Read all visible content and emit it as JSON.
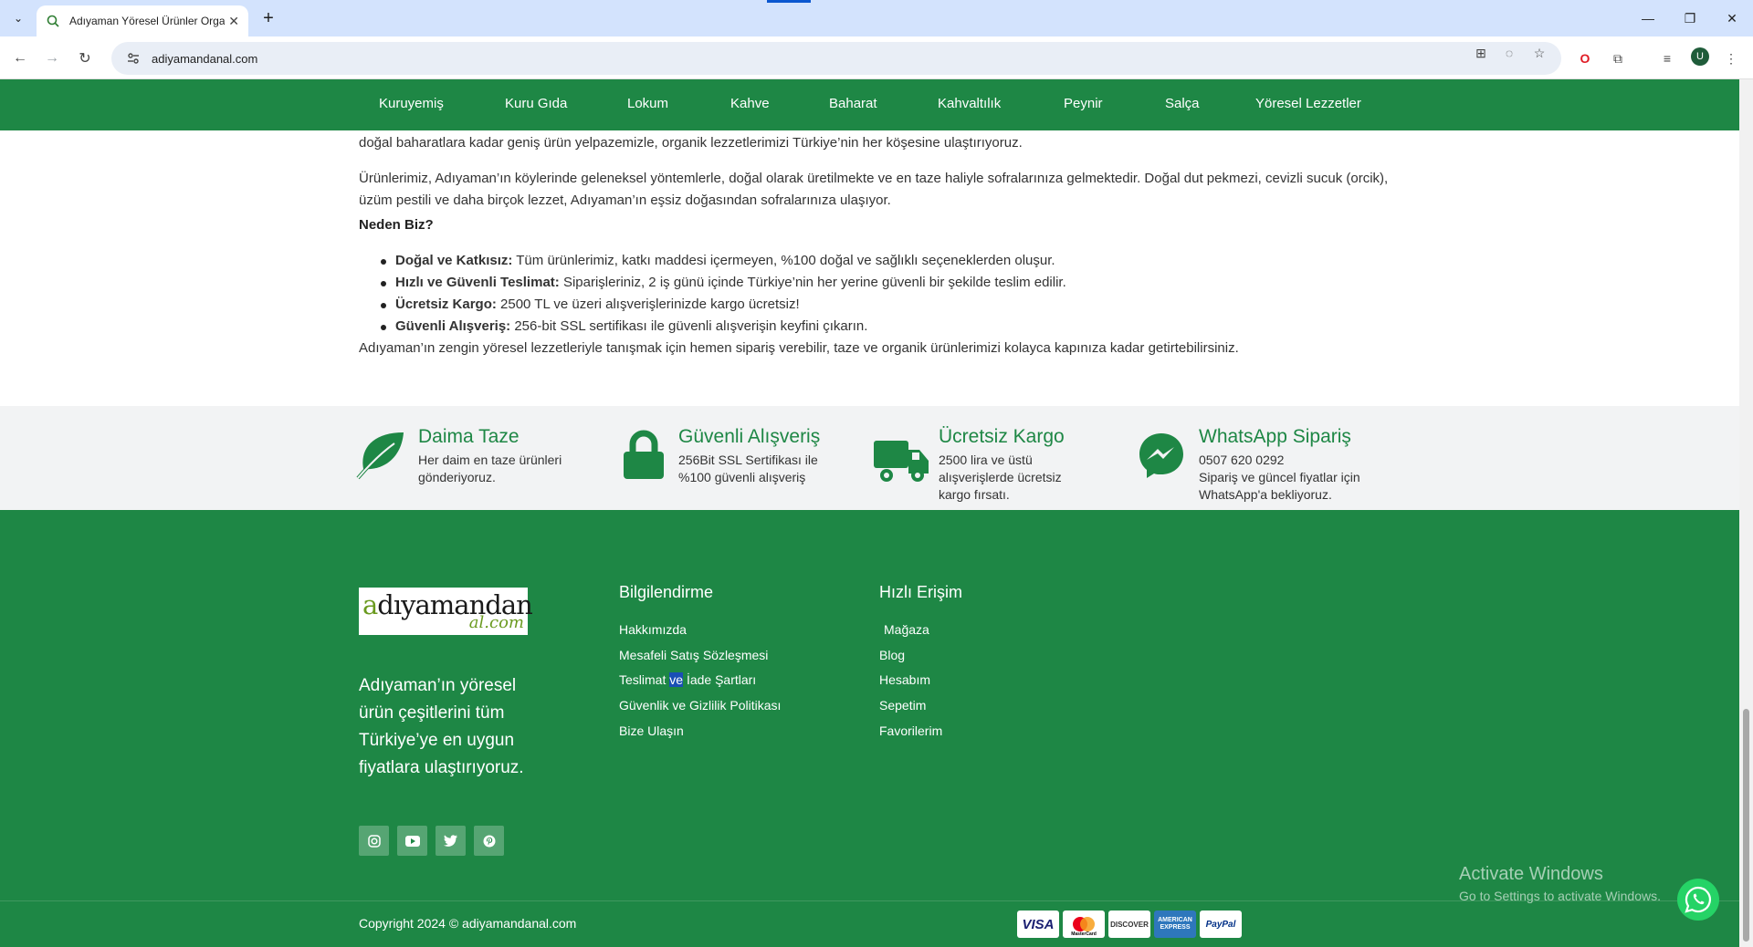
{
  "browser": {
    "tab_title": "Adıyaman Yöresel Ürünler Organik",
    "url": "adiyamandanal.com",
    "profile_initial": "U"
  },
  "catnav": [
    "Kuruyemiş",
    "Kuru Gıda",
    "Lokum",
    "Kahve",
    "Baharat",
    "Kahvaltılık",
    "Peynir",
    "Salça",
    "Yöresel Lezzetler"
  ],
  "article": {
    "p0": "doğal baharatlara kadar geniş ürün yelpazemizle, organik lezzetlerimizi Türkiye’nin her köşesine ulaştırıyoruz.",
    "p1": "Ürünlerimiz, Adıyaman’ın köylerinde geleneksel yöntemlerle, doğal olarak üretilmekte ve en taze haliyle sofralarınıza gelmektedir. Doğal dut pekmezi, cevizli sucuk (orcik), üzüm pestili ve daha birçok lezzet, Adıyaman’ın eşsiz doğasından sofralarınıza ulaşıyor.",
    "why_title": "Neden Biz?",
    "bullets": [
      {
        "bold": "Doğal ve Katkısız:",
        "text": " Tüm ürünlerimiz, katkı maddesi içermeyen, %100 doğal ve sağlıklı seçeneklerden oluşur."
      },
      {
        "bold": "Hızlı ve Güvenli Teslimat:",
        "text": " Siparişleriniz, 2 iş günü içinde Türkiye’nin her yerine güvenli bir şekilde teslim edilir."
      },
      {
        "bold": "Ücretsiz Kargo:",
        "text": " 2500 TL ve üzeri alışverişlerinizde kargo ücretsiz!"
      },
      {
        "bold": "Güvenli Alışveriş:",
        "text": " 256-bit SSL sertifikası ile güvenli alışverişin keyfini çıkarın."
      }
    ],
    "closing": "Adıyaman’ın zengin yöresel lezzetleriyle tanışmak için hemen sipariş verebilir, taze ve organik ürünlerimizi kolayca kapınıza kadar getirtebilirsiniz."
  },
  "features": [
    {
      "title": "Daima Taze",
      "desc": "Her daim en taze ürünleri gönderiyoruz.",
      "icon": "leaf-icon"
    },
    {
      "title": "Güvenli Alışveriş",
      "desc": "256Bit SSL Sertifikası ile %100 güvenli alışveriş",
      "icon": "lock-icon"
    },
    {
      "title": "Ücretsiz Kargo",
      "desc": "2500 lira ve üstü alışverişlerde ücretsiz kargo fırsatı.",
      "icon": "truck-icon"
    },
    {
      "title": "WhatsApp Sipariş",
      "phone": "0507 620 0292",
      "desc": "Sipariş ve güncel fiyatlar için WhatsApp'a bekliyoruz.",
      "icon": "messenger-icon"
    }
  ],
  "footer": {
    "logo_top_a": "a",
    "logo_top_rest": "dıyamandan",
    "logo_bottom": "al.com",
    "tagline": "Adıyaman’ın yöresel ürün çeşitlerini tüm Türkiye’ye en uygun fiyatlara ulaştırıyoruz.",
    "info_title": "Bilgilendirme",
    "info_links": [
      "Hakkımızda",
      "Mesafeli Satış Sözleşmesi",
      "Teslimat",
      "ve",
      "İade Şartları",
      "Güvenlik ve Gizlilik Politikası",
      "Bize Ulaşın"
    ],
    "quick_title": "Hızlı Erişim",
    "quick_links": [
      "Mağaza",
      "Blog",
      "Hesabım",
      "Sepetim",
      "Favorilerim"
    ],
    "copyright": "Copyright 2024 © adiyamandanal.com",
    "payments": [
      "VISA",
      "MasterCard",
      "DISCOVER",
      "AMERICAN EXPRESS",
      "PayPal"
    ]
  },
  "watermark": {
    "title": "Activate Windows",
    "subtitle": "Go to Settings to activate Windows."
  }
}
